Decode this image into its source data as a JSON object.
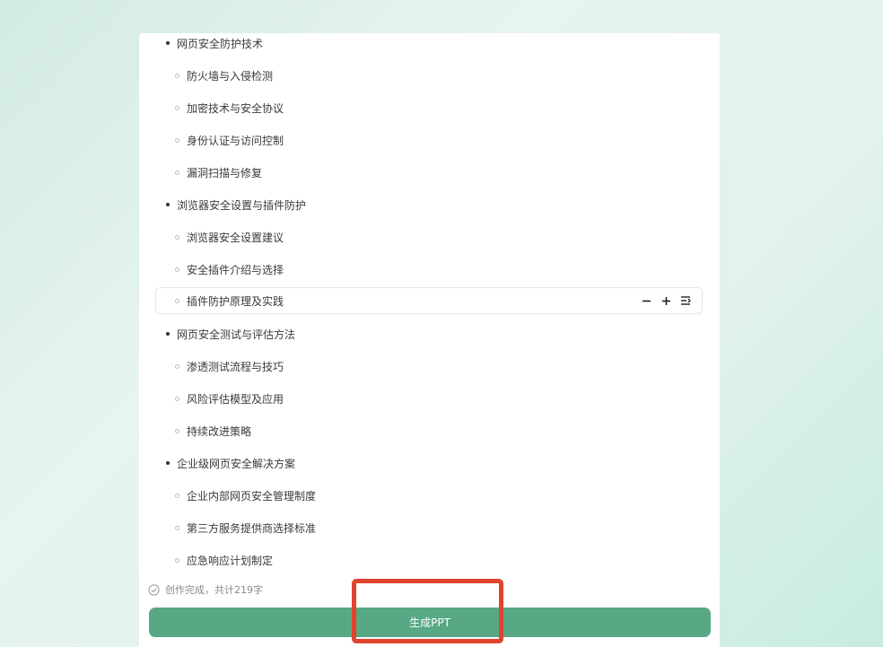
{
  "outline": [
    {
      "level": 1,
      "label": "网页安全防护技术"
    },
    {
      "level": 2,
      "label": "防火墙与入侵检测"
    },
    {
      "level": 2,
      "label": "加密技术与安全协议"
    },
    {
      "level": 2,
      "label": "身份认证与访问控制"
    },
    {
      "level": 2,
      "label": "漏洞扫描与修复"
    },
    {
      "level": 1,
      "label": "浏览器安全设置与插件防护"
    },
    {
      "level": 2,
      "label": "浏览器安全设置建议"
    },
    {
      "level": 2,
      "label": "安全插件介绍与选择"
    },
    {
      "level": 2,
      "label": "插件防护原理及实践",
      "hovered": true
    },
    {
      "level": 1,
      "label": "网页安全测试与评估方法"
    },
    {
      "level": 2,
      "label": "渗透测试流程与技巧"
    },
    {
      "level": 2,
      "label": "风险评估模型及应用"
    },
    {
      "level": 2,
      "label": "持续改进策略"
    },
    {
      "level": 1,
      "label": "企业级网页安全解决方案"
    },
    {
      "level": 2,
      "label": "企业内部网页安全管理制度"
    },
    {
      "level": 2,
      "label": "第三方服务提供商选择标准"
    },
    {
      "level": 2,
      "label": "应急响应计划制定"
    }
  ],
  "row_tools": [
    "minus-icon",
    "plus-icon",
    "indent-icon"
  ],
  "status": {
    "text": "创作完成，共计219字",
    "icon": "check-circle-icon"
  },
  "generate_button": {
    "label": "生成PPT"
  },
  "colors": {
    "accent": "#58a886",
    "highlight": "#e2432e"
  }
}
